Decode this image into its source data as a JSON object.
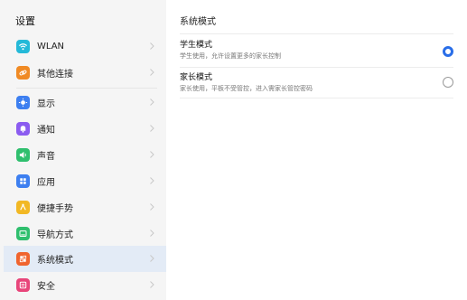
{
  "sidebar": {
    "title": "设置",
    "items": [
      {
        "label": "WLAN",
        "icon": "wifi-icon",
        "color": "#24b9d8"
      },
      {
        "label": "其他连接",
        "icon": "link-icon",
        "color": "#f08a24"
      },
      {
        "label": "显示",
        "icon": "display-icon",
        "color": "#3d7ff0"
      },
      {
        "label": "通知",
        "icon": "bell-icon",
        "color": "#8b5cf0"
      },
      {
        "label": "声音",
        "icon": "speaker-icon",
        "color": "#2fbf6e"
      },
      {
        "label": "应用",
        "icon": "apps-icon",
        "color": "#3d7ff0"
      },
      {
        "label": "便捷手势",
        "icon": "gesture-icon",
        "color": "#f2b824"
      },
      {
        "label": "导航方式",
        "icon": "navigation-icon",
        "color": "#2fbf6e"
      },
      {
        "label": "系统模式",
        "icon": "system-mode-icon",
        "color": "#f0642e"
      },
      {
        "label": "安全",
        "icon": "security-icon",
        "color": "#e8457a"
      }
    ]
  },
  "main": {
    "title": "系统模式",
    "options": [
      {
        "title": "学生模式",
        "subtitle": "学生使用，允许设置更多的家长控制",
        "selected": true
      },
      {
        "title": "家长模式",
        "subtitle": "家长使用，平板不受管控，进入需家长管控密码",
        "selected": false
      }
    ]
  },
  "colors": {
    "accent": "#2a6ee8",
    "selected_bg": "#e3ebf6"
  }
}
